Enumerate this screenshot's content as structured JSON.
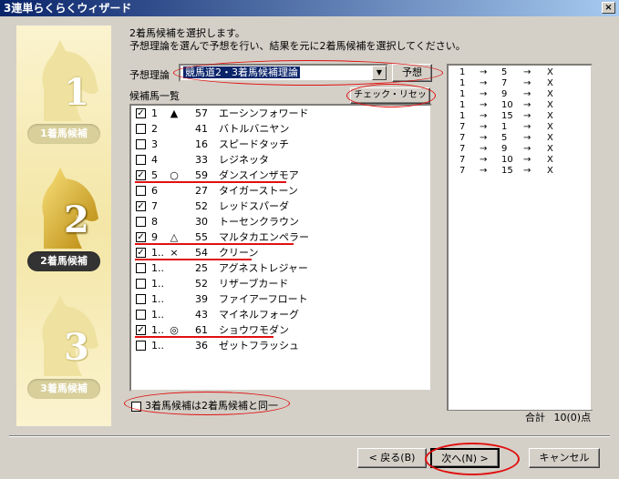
{
  "window": {
    "title": "3連単らくらくウィザード",
    "close_label": "×"
  },
  "sidebar": {
    "steps": [
      {
        "num": "1",
        "label": "1着馬候補"
      },
      {
        "num": "2",
        "label": "2着馬候補"
      },
      {
        "num": "3",
        "label": "3着馬候補"
      }
    ],
    "active_step": 2
  },
  "instructions": {
    "line1": "2着馬候補を選択します。",
    "line2": "予想理論を選んで予想を行い、結果を元に2着馬候補を選択してください。"
  },
  "theory": {
    "label": "予想理論",
    "selected": "競馬道2・3着馬候補理論",
    "predict_button": "予想"
  },
  "candidates": {
    "label": "候補馬一覧",
    "check_reset_button": "チェック・リセット",
    "rows": [
      {
        "checked": true,
        "no": "1",
        "mark": "▲",
        "pts": "57",
        "name": "エーシンフォワード"
      },
      {
        "checked": false,
        "no": "2",
        "mark": "",
        "pts": "41",
        "name": "バトルバニヤン"
      },
      {
        "checked": false,
        "no": "3",
        "mark": "",
        "pts": "16",
        "name": "スピードタッチ"
      },
      {
        "checked": false,
        "no": "4",
        "mark": "",
        "pts": "33",
        "name": "レジネッタ"
      },
      {
        "checked": true,
        "no": "5",
        "mark": "○",
        "pts": "59",
        "name": "ダンスインザモア"
      },
      {
        "checked": false,
        "no": "6",
        "mark": "",
        "pts": "27",
        "name": "タイガーストーン"
      },
      {
        "checked": true,
        "no": "7",
        "mark": "",
        "pts": "52",
        "name": "レッドスパーダ"
      },
      {
        "checked": false,
        "no": "8",
        "mark": "",
        "pts": "30",
        "name": "トーセンクラウン"
      },
      {
        "checked": true,
        "no": "9",
        "mark": "△",
        "pts": "55",
        "name": "マルタカエンペラー"
      },
      {
        "checked": true,
        "no": "1..",
        "mark": "×",
        "pts": "54",
        "name": "クリーン"
      },
      {
        "checked": false,
        "no": "1..",
        "mark": "",
        "pts": "25",
        "name": "アグネストレジャー"
      },
      {
        "checked": false,
        "no": "1..",
        "mark": "",
        "pts": "52",
        "name": "リザーブカード"
      },
      {
        "checked": false,
        "no": "1..",
        "mark": "",
        "pts": "39",
        "name": "ファイアーフロート"
      },
      {
        "checked": false,
        "no": "1..",
        "mark": "",
        "pts": "43",
        "name": "マイネルフォーグ"
      },
      {
        "checked": true,
        "no": "1..",
        "mark": "◎",
        "pts": "61",
        "name": "ショウワモダン"
      },
      {
        "checked": false,
        "no": "1..",
        "mark": "",
        "pts": "36",
        "name": "ゼットフラッシュ"
      }
    ]
  },
  "same_as_second": {
    "label": "3着馬候補は2着馬候補と同一",
    "checked": false
  },
  "results": {
    "arrow": "→",
    "rows": [
      {
        "first": "1",
        "second": "5",
        "third": "X"
      },
      {
        "first": "1",
        "second": "7",
        "third": "X"
      },
      {
        "first": "1",
        "second": "9",
        "third": "X"
      },
      {
        "first": "1",
        "second": "10",
        "third": "X"
      },
      {
        "first": "1",
        "second": "15",
        "third": "X"
      },
      {
        "first": "7",
        "second": "1",
        "third": "X"
      },
      {
        "first": "7",
        "second": "5",
        "third": "X"
      },
      {
        "first": "7",
        "second": "9",
        "third": "X"
      },
      {
        "first": "7",
        "second": "10",
        "third": "X"
      },
      {
        "first": "7",
        "second": "15",
        "third": "X"
      }
    ],
    "total_label": "合計",
    "total_value": "10(0)点"
  },
  "footer": {
    "back_button": "< 戻る(B)",
    "next_button": "次へ(N) >",
    "cancel_button": "キャンセル"
  },
  "colors": {
    "annotation": "#e01010",
    "title_gradient_start": "#0a246a",
    "title_gradient_end": "#a6caf0",
    "active_label_bg": "#333333"
  }
}
